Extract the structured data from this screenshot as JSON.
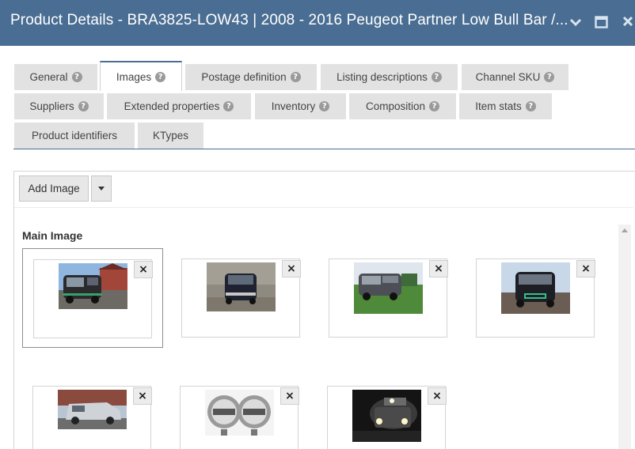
{
  "window": {
    "title": "Product Details - BRA3825-LOW43 | 2008 - 2016 Peugeot Partner Low Bull Bar /...",
    "controls": [
      "chevron-down-icon",
      "maximize-icon",
      "close-icon"
    ]
  },
  "tabs": {
    "row1": [
      {
        "label": "General",
        "help": true
      },
      {
        "label": "Images",
        "help": true,
        "active": true
      },
      {
        "label": "Postage definition",
        "help": true
      },
      {
        "label": "Listing descriptions",
        "help": true
      },
      {
        "label": "Channel SKU",
        "help": true
      }
    ],
    "row2": [
      {
        "label": "Suppliers",
        "help": true
      },
      {
        "label": "Extended properties",
        "help": true
      },
      {
        "label": "Inventory",
        "help": true
      },
      {
        "label": "Composition",
        "help": true
      },
      {
        "label": "Item stats",
        "help": true
      }
    ],
    "row3": [
      {
        "label": "Product identifiers",
        "help": false
      },
      {
        "label": "KTypes",
        "help": false
      }
    ],
    "help_glyph": "?"
  },
  "toolbar": {
    "add_image_label": "Add Image"
  },
  "section": {
    "main_image_title": "Main Image"
  },
  "images": {
    "remove_glyph": "×",
    "items": [
      {
        "subject": "dark-van-front-three-quarter",
        "selected": true
      },
      {
        "subject": "dark-van-front-rocky-background",
        "selected": false
      },
      {
        "subject": "grey-van-on-grass",
        "selected": false
      },
      {
        "subject": "black-van-front-with-bull-bar",
        "selected": false
      },
      {
        "subject": "silver-van-side-view",
        "selected": false
      },
      {
        "subject": "pair-of-round-spot-lamps",
        "selected": false
      },
      {
        "subject": "van-at-night-with-lights",
        "selected": false
      }
    ]
  },
  "colors": {
    "titlebar": "#4a6e93",
    "tab_bg": "#e2e2e2",
    "accent": "#4a6e93"
  }
}
